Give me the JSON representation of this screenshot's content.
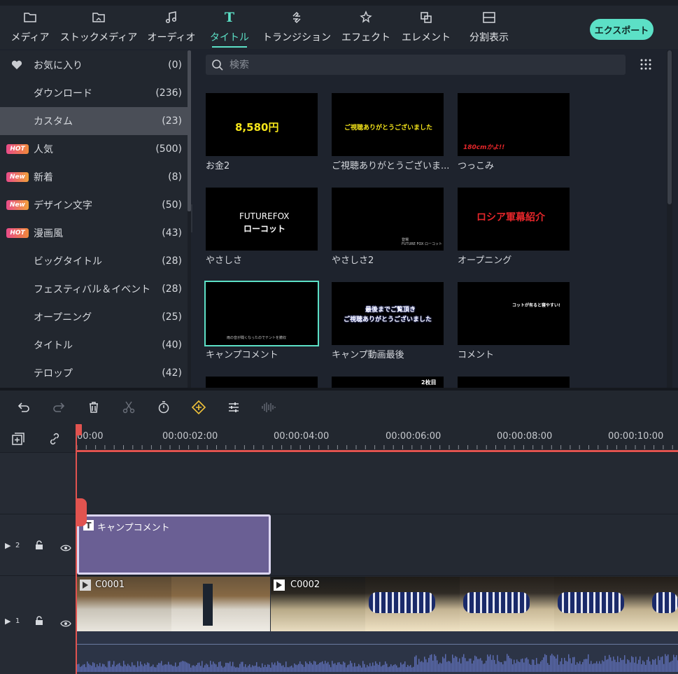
{
  "tabs": [
    {
      "label": "メディア",
      "icon": "folder-icon"
    },
    {
      "label": "ストックメディア",
      "icon": "stock-media-icon"
    },
    {
      "label": "オーディオ",
      "icon": "music-note-icon"
    },
    {
      "label": "タイトル",
      "icon": "title-t-icon",
      "active": true
    },
    {
      "label": "トランジション",
      "icon": "transition-icon"
    },
    {
      "label": "エフェクト",
      "icon": "effect-star-icon"
    },
    {
      "label": "エレメント",
      "icon": "element-icon"
    },
    {
      "label": "分割表示",
      "icon": "split-screen-icon"
    }
  ],
  "export_label": "エクスポート",
  "sidebar": {
    "items": [
      {
        "name": "お気に入り",
        "count": "(0)",
        "badge": "",
        "icon": "heart-icon"
      },
      {
        "name": "ダウンロード",
        "count": "(236)",
        "badge": ""
      },
      {
        "name": "カスタム",
        "count": "(23)",
        "badge": "",
        "active": true
      },
      {
        "name": "人気",
        "count": "(500)",
        "badge": "HOT"
      },
      {
        "name": "新着",
        "count": "(8)",
        "badge": "New"
      },
      {
        "name": "デザイン文字",
        "count": "(50)",
        "badge": "New"
      },
      {
        "name": "漫画風",
        "count": "(43)",
        "badge": "HOT"
      },
      {
        "name": "ビッグタイトル",
        "count": "(28)",
        "badge": ""
      },
      {
        "name": "フェスティバル＆イベント",
        "count": "(28)",
        "badge": ""
      },
      {
        "name": "オープニング",
        "count": "(25)",
        "badge": ""
      },
      {
        "name": "タイトル",
        "count": "(40)",
        "badge": ""
      },
      {
        "name": "テロップ",
        "count": "(42)",
        "badge": ""
      }
    ]
  },
  "search": {
    "placeholder": "検索"
  },
  "cards": [
    {
      "caption": "お金2",
      "text": "8,580円",
      "color": "#f5e51a"
    },
    {
      "caption": "ご視聴ありがとうございま...",
      "text": "ご視聴ありがとうございました",
      "color": "#f5e51a"
    },
    {
      "caption": "つっこみ",
      "text": "180cmかよ!!",
      "color": "#e5262a"
    },
    {
      "caption": "やさしさ",
      "text": "FUTUREFOX",
      "text2": "ローコット",
      "color": "#ffffff"
    },
    {
      "caption": "やさしさ2",
      "text": "登場",
      "text2": "FUTURE FOX ローコット",
      "color": "#cccccc"
    },
    {
      "caption": "オープニング",
      "text": "ロシア軍幕紹介",
      "color": "#e5262a"
    },
    {
      "caption": "キャンプコメント",
      "text": "雨の音が聞くなったのでテントを撤収",
      "color": "#cccccc",
      "selected": true
    },
    {
      "caption": "キャンプ動画最後",
      "text": "最後までご覧頂き",
      "text2": "ご視聴ありがとうございました",
      "color": "#ffffff"
    },
    {
      "caption": "コメント",
      "text": "コットが有ると寝やすい!",
      "color": "#ffffff"
    },
    {
      "caption": "",
      "text": "",
      "color": "#ffffff"
    },
    {
      "caption": "",
      "text": "2枚目",
      "color": "#ffffff"
    },
    {
      "caption": "",
      "text": "",
      "color": "#ffffff"
    }
  ],
  "toolbar": {
    "buttons": [
      "undo-icon",
      "redo-icon",
      "delete-icon",
      "cut-icon",
      "speed-timer-icon",
      "keyframe-add-icon",
      "adjust-icon",
      "audio-icon"
    ]
  },
  "ruler": {
    "labels": [
      "00:00",
      "00:00:02:00",
      "00:00:04:00",
      "00:00:06:00",
      "00:00:08:00",
      "00:00:10:00"
    ]
  },
  "tracks": {
    "track2_label": "2",
    "track1_label": "1",
    "title_clip_name": "キャンプコメント",
    "video_clip1_name": "C0001",
    "video_clip2_name": "C0002"
  },
  "colors": {
    "accent": "#5ce0c6",
    "playhead": "#e1534f",
    "title_clip": "#6a5f94"
  }
}
